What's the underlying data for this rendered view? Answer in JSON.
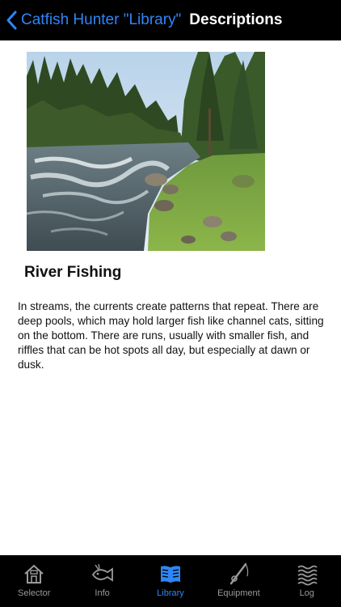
{
  "navbar": {
    "back_label": "Catfish Hunter \"Library\"",
    "title": "Descriptions"
  },
  "article": {
    "image_alt": "",
    "heading": "River Fishing",
    "description": "In streams, the currents create patterns that repeat. There are deep pools, which may hold larger fish like channel cats, sitting on the bottom. There are runs, usually with smaller fish, and riffles that can be hot spots all day, but especially at dawn or dusk."
  },
  "tabbar": {
    "tabs": [
      {
        "label": "Selector",
        "icon": "house-icon",
        "active": false
      },
      {
        "label": "Info",
        "icon": "fish-icon",
        "active": false
      },
      {
        "label": "Library",
        "icon": "book-icon",
        "active": true
      },
      {
        "label": "Equipment",
        "icon": "fishing-rod-icon",
        "active": false
      },
      {
        "label": "Log",
        "icon": "waves-icon",
        "active": false
      }
    ]
  },
  "colors": {
    "accent": "#2f86f6",
    "bar_background": "#000000",
    "inactive_tab": "#9a9a9a"
  }
}
